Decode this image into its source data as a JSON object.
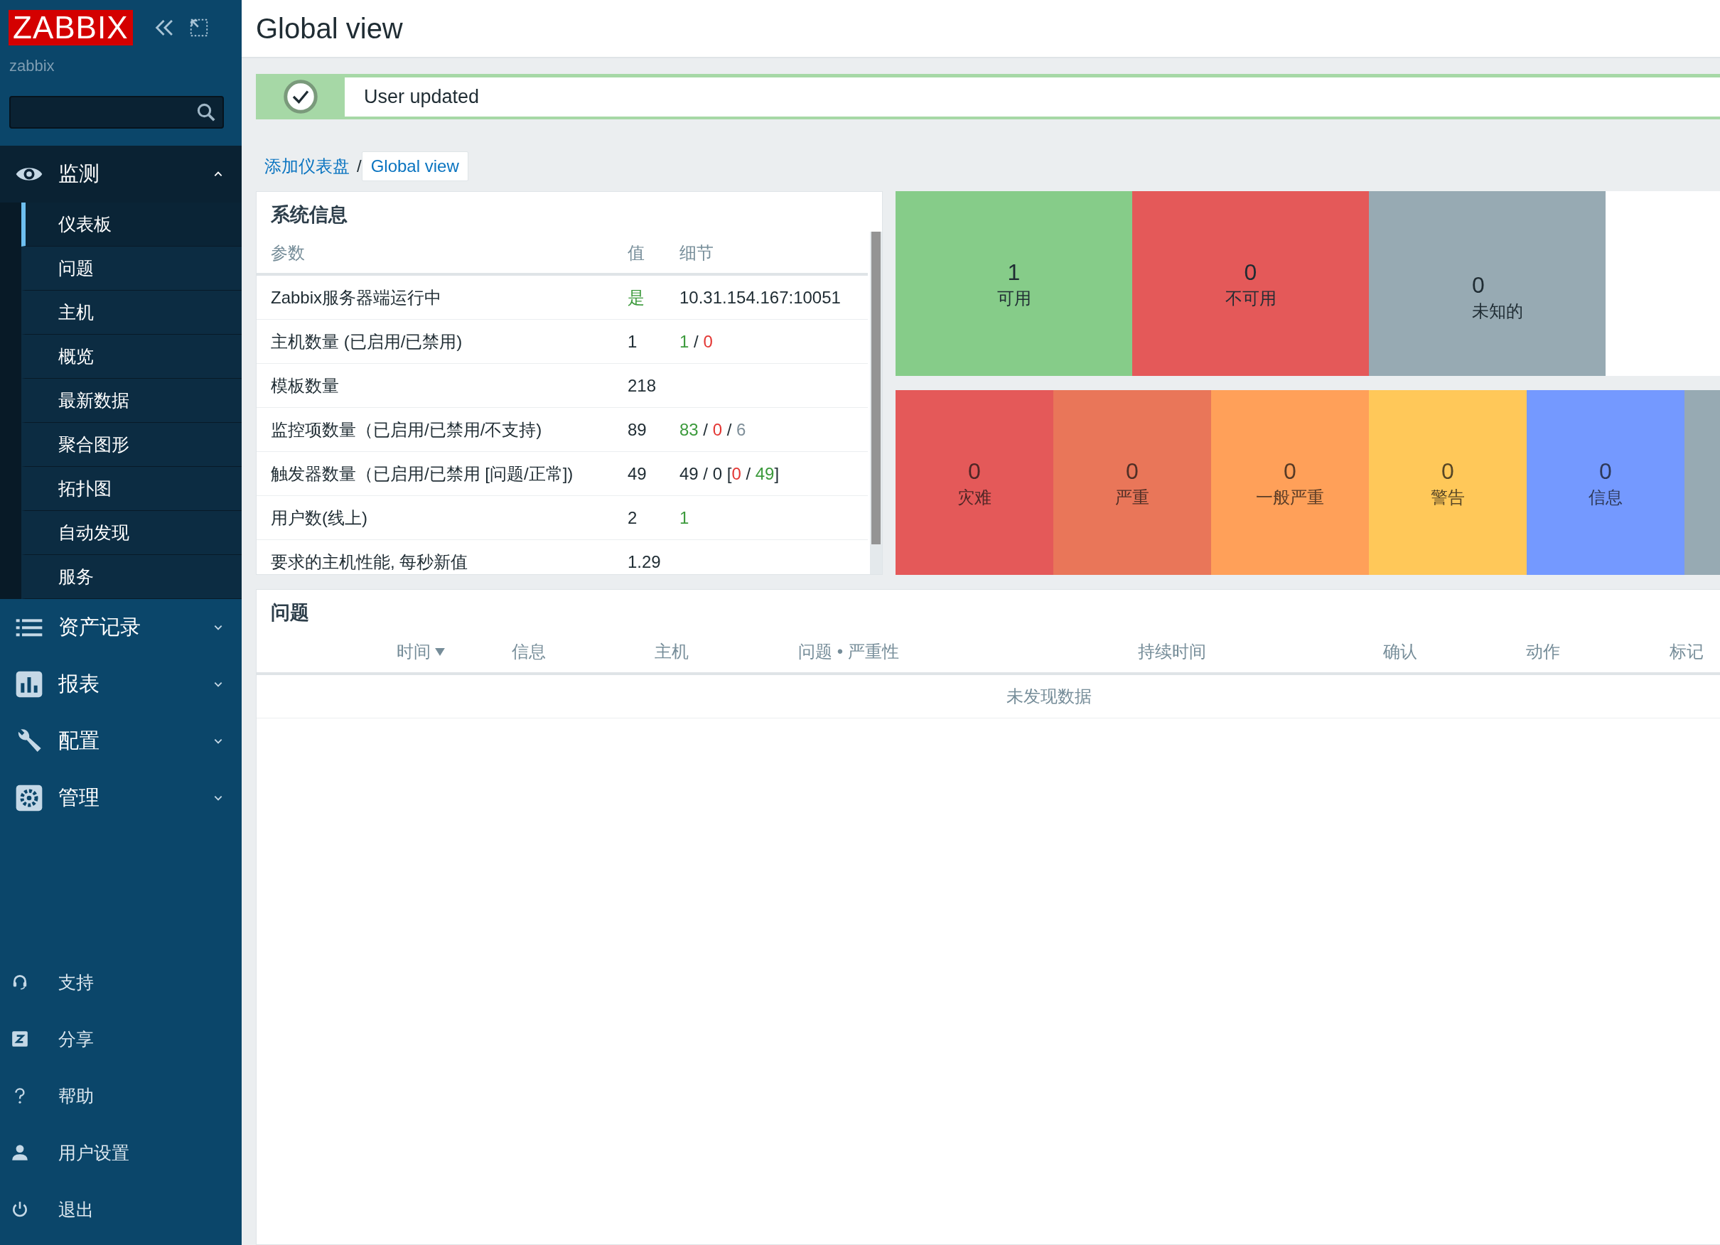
{
  "sidebar": {
    "logo": "ZABBIX",
    "server_name": "zabbix",
    "menu": [
      {
        "label": "监测",
        "expanded": true,
        "children": [
          {
            "label": "仪表板",
            "selected": true
          },
          {
            "label": "问题",
            "selected": false
          },
          {
            "label": "主机",
            "selected": false
          },
          {
            "label": "概览",
            "selected": false
          },
          {
            "label": "最新数据",
            "selected": false
          },
          {
            "label": "聚合图形",
            "selected": false
          },
          {
            "label": "拓扑图",
            "selected": false
          },
          {
            "label": "自动发现",
            "selected": false
          },
          {
            "label": "服务",
            "selected": false
          }
        ]
      },
      {
        "label": "资产记录",
        "expanded": false
      },
      {
        "label": "报表",
        "expanded": false
      },
      {
        "label": "配置",
        "expanded": false
      },
      {
        "label": "管理",
        "expanded": false
      }
    ],
    "footer_links": [
      "支持",
      "分享",
      "帮助",
      "用户设置",
      "退出"
    ]
  },
  "header": {
    "title": "Global view"
  },
  "message": "User updated",
  "breadcrumb": {
    "separator": "/",
    "items": [
      "添加仪表盘",
      "Global view"
    ]
  },
  "system_info": {
    "title": "系统信息",
    "columns": [
      "参数",
      "值",
      "细节"
    ],
    "rows": [
      {
        "parameter": "Zabbix服务器端运行中",
        "value": [
          {
            "text": "是",
            "color": "#3c9a3c"
          }
        ],
        "details": [
          {
            "text": "10.31.154.167:10051"
          }
        ]
      },
      {
        "parameter": "主机数量 (已启用/已禁用)",
        "value": [
          {
            "text": "1"
          }
        ],
        "details": [
          {
            "text": "1",
            "color": "#3c9a3c"
          },
          {
            "text": " / "
          },
          {
            "text": "0",
            "color": "#e33734"
          }
        ]
      },
      {
        "parameter": "模板数量",
        "value": [
          {
            "text": "218"
          }
        ],
        "details": []
      },
      {
        "parameter": "监控项数量（已启用/已禁用/不支持)",
        "value": [
          {
            "text": "89"
          }
        ],
        "details": [
          {
            "text": "83",
            "color": "#3c9a3c"
          },
          {
            "text": " / "
          },
          {
            "text": "0",
            "color": "#e33734"
          },
          {
            "text": " / "
          },
          {
            "text": "6",
            "color": "#7f8f99"
          }
        ]
      },
      {
        "parameter": "触发器数量（已启用/已禁用 [问题/正常])",
        "value": [
          {
            "text": "49"
          }
        ],
        "details": [
          {
            "text": "49 / 0 ["
          },
          {
            "text": "0",
            "color": "#e33734"
          },
          {
            "text": " / "
          },
          {
            "text": "49",
            "color": "#3c9a3c"
          },
          {
            "text": "]"
          }
        ]
      },
      {
        "parameter": "用户数(线上)",
        "value": [
          {
            "text": "2"
          }
        ],
        "details": [
          {
            "text": "1",
            "color": "#3c9a3c"
          }
        ]
      },
      {
        "parameter": "要求的主机性能, 每秒新值",
        "value": [
          {
            "text": "1.29"
          }
        ],
        "details": []
      }
    ]
  },
  "host_availability": [
    {
      "count": "1",
      "label": "可用",
      "color": "#86cc89"
    },
    {
      "count": "0",
      "label": "不可用",
      "color": "#e45959"
    },
    {
      "count": "0",
      "label": "未知的",
      "color": "#97aab3"
    }
  ],
  "problems_by_severity": [
    {
      "count": "0",
      "label": "灾难",
      "color": "#e45959"
    },
    {
      "count": "0",
      "label": "严重",
      "color": "#e97659"
    },
    {
      "count": "0",
      "label": "一般严重",
      "color": "#ffa059"
    },
    {
      "count": "0",
      "label": "警告",
      "color": "#ffc859"
    },
    {
      "count": "0",
      "label": "信息",
      "color": "#7499ff"
    },
    {
      "color": "#97aab3"
    }
  ],
  "problems": {
    "title": "问题",
    "columns": [
      {
        "label": "时间",
        "sorted": true
      },
      {
        "label": "信息",
        "sorted": false
      },
      {
        "label": "主机",
        "sorted": false
      },
      {
        "label": "问题 • 严重性",
        "sorted": false
      },
      {
        "label": "持续时间",
        "sorted": false
      },
      {
        "label": "确认",
        "sorted": false
      },
      {
        "label": "动作",
        "sorted": false
      },
      {
        "label": "标记",
        "sorted": false
      }
    ],
    "empty_text": "未发现数据"
  }
}
